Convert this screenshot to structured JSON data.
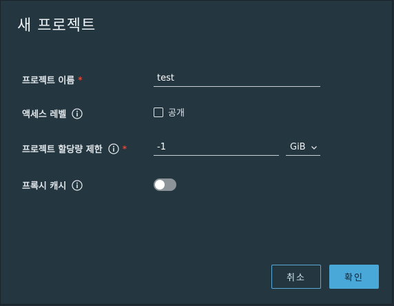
{
  "dialog": {
    "title": "새 프로젝트"
  },
  "form": {
    "project_name": {
      "label": "프로젝트 이름",
      "required_mark": "*",
      "value": "test"
    },
    "access_level": {
      "label": "액세스 레벨",
      "checkbox_label": "공개",
      "checked": false
    },
    "quota": {
      "label": "프로젝트 할당량 제한",
      "required_mark": "*",
      "value": "-1",
      "unit": "GiB"
    },
    "proxy_cache": {
      "label": "프록시 캐시",
      "enabled": false
    }
  },
  "buttons": {
    "cancel_label": "취소",
    "ok_label": "확인"
  },
  "colors": {
    "dialog_background": "#243640",
    "primary": "#4aa8d8",
    "required": "#e0473b"
  },
  "icons": {
    "info": "info-circle-icon",
    "dropdown": "chevron-down-icon"
  }
}
